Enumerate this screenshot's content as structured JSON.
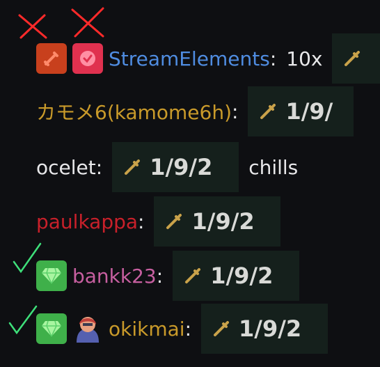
{
  "colors": {
    "background": "#0e0f12",
    "streamelements": "#4f8ce0",
    "kamome": "#c99a2a",
    "ocelet": "#e8e8ea",
    "paulkappa": "#c8202a",
    "bankk23": "#c75fa0",
    "okikmai": "#c99a2a",
    "x_mark": "#ff2a2a",
    "check_mark": "#3ee07a",
    "emote_bg": "#15201c"
  },
  "messages": [
    {
      "user": "StreamElements",
      "colon": ":",
      "text_before": "10x",
      "emote_text": "",
      "text_after": "",
      "badges": [
        "sword-badge",
        "verified-badge"
      ],
      "annotation": "x"
    },
    {
      "user": "カモメ6(kamome6h)",
      "colon": ":",
      "text_before": "",
      "emote_text": "1/9/",
      "text_after": "",
      "badges": []
    },
    {
      "user": "ocelet",
      "colon": ":",
      "text_before": "",
      "emote_text": "1/9/2",
      "text_after": "chills",
      "badges": []
    },
    {
      "user": "paulkappa",
      "colon": ":",
      "text_before": "",
      "emote_text": "1/9/2",
      "text_after": "",
      "badges": []
    },
    {
      "user": "bankk23",
      "colon": ":",
      "text_before": "",
      "emote_text": "1/9/2",
      "text_after": "",
      "badges": [
        "subscriber-badge"
      ],
      "annotation": "check"
    },
    {
      "user": "okikmai",
      "colon": ":",
      "text_before": "",
      "emote_text": "1/9/2",
      "text_after": "",
      "badges": [
        "subscriber-badge",
        "avatar-badge"
      ],
      "annotation": "check"
    }
  ]
}
